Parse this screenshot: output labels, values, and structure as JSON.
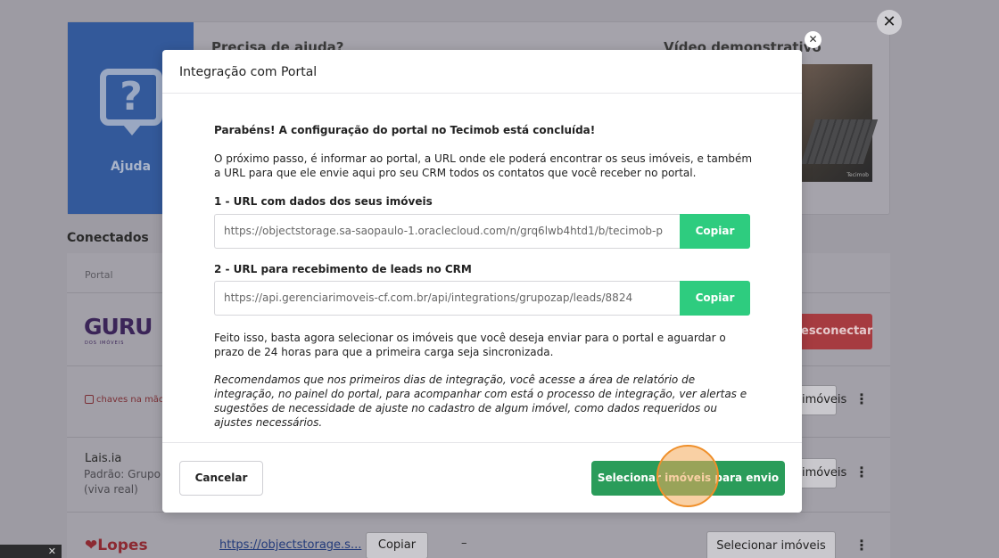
{
  "background": {
    "help_card": {
      "help_label": "Ajuda",
      "help_title": "Precisa de ajuda?",
      "video_title": "Vídeo demonstrativo",
      "video_watermark": "Tecimob"
    },
    "outer_close": "✕",
    "connected_title": "Conectados",
    "portal_header": "Portal",
    "rows": {
      "guru": {
        "logo": "GURU",
        "sub": "DOS IMÓVEIS",
        "disconnect": "esconectar"
      },
      "chaves": {
        "logo": "chaves na mão",
        "button": "imóveis"
      },
      "lais": {
        "name": "Lais.ia",
        "sub_line1": "Padrão: Grupo",
        "sub_line2": "(viva real)",
        "button": "imóveis"
      },
      "lopes": {
        "logo": "Lopes",
        "link": "https://objectstorage.s...",
        "copy": "Copiar",
        "dash": "–",
        "select": "Selecionar imóveis"
      }
    },
    "toast_close": "✕"
  },
  "modal": {
    "title": "Integração com Portal",
    "close": "✕",
    "congrats": "Parabéns! A configuração do portal no Tecimob está concluída!",
    "intro": "O próximo passo, é informar ao portal, a URL onde ele poderá encontrar os seus imóveis, e também a URL para que ele envie aqui pro seu CRM todos os contatos que você receber no portal.",
    "url1_label": "1 - URL com dados dos seus imóveis",
    "url1_value": "https://objectstorage.sa-saopaulo-1.oraclecloud.com/n/grq6lwb4htd1/b/tecimob-p",
    "url2_label": "2 - URL para recebimento de leads no CRM",
    "url2_value": "https://api.gerenciarimoveis-cf.com.br/api/integrations/grupozap/leads/8824",
    "copy_label": "Copiar",
    "after_text": "Feito isso, basta agora selecionar os imóveis que você deseja enviar para o portal e aguardar o prazo de 24 horas para que a primeira carga seja sincronizada.",
    "recommend": "Recomendamos que nos primeiros dias de integração, você acesse a área de relatório de integração, no painel do portal, para acompanhar com está o processo de integração, ver alertas e sugestões de necessidade de ajuste no cadastro de algum imóvel, como dados requeridos ou ajustes necessários.",
    "cancel": "Cancelar",
    "select": "Selecionar imóveis para envio"
  },
  "colors": {
    "copy_button": "#2ecc7f",
    "primary_button": "#2a9c5a",
    "click_indicator": "#ef8f2a"
  }
}
